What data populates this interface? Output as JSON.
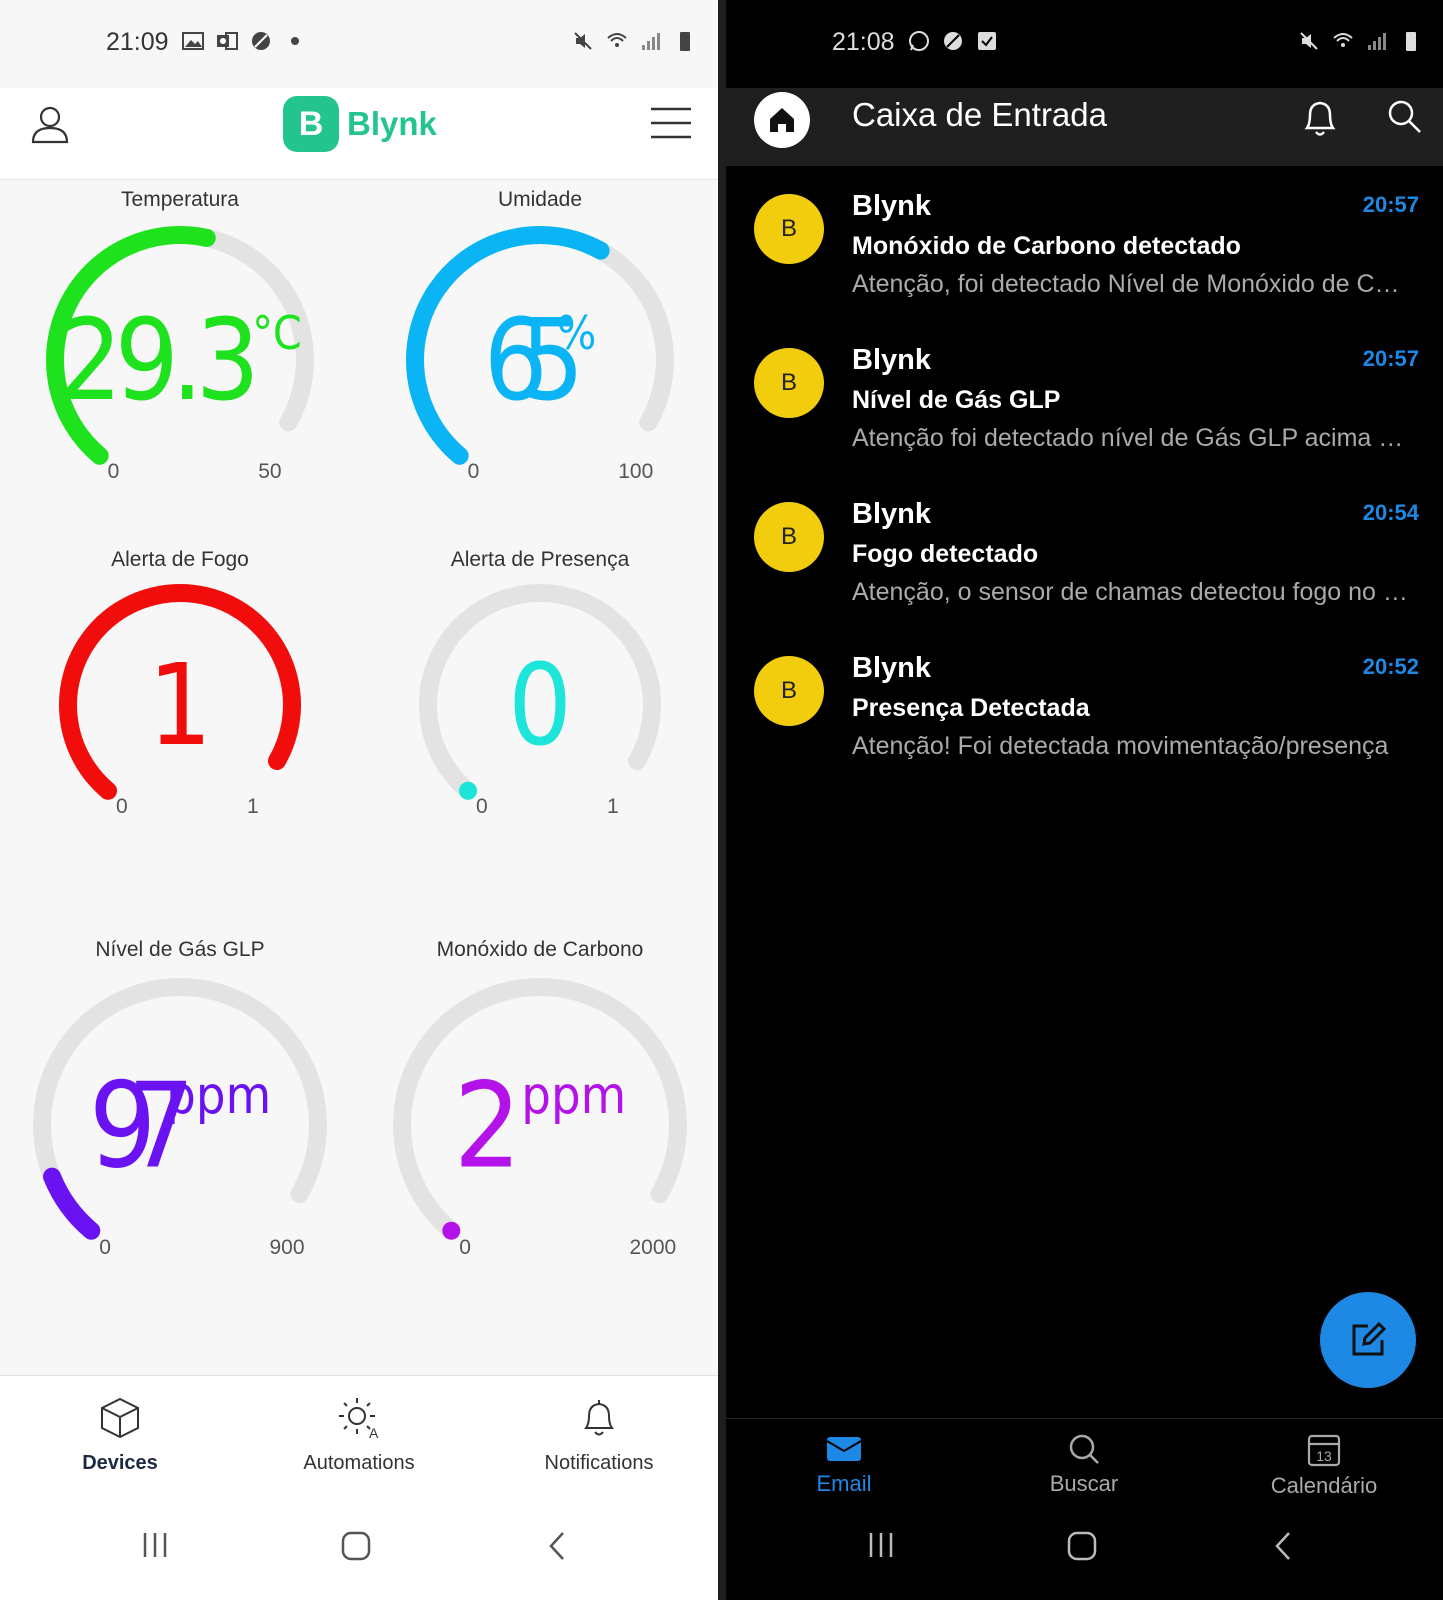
{
  "left_screen": {
    "status_bar": {
      "time": "21:09"
    },
    "header": {
      "logo_letter": "B",
      "app_name": "Blynk"
    },
    "gauges": [
      {
        "id": "temperatura",
        "title": "Temperatura",
        "value": "29.3",
        "unit": "°C",
        "min": "0",
        "max": "50",
        "numeric_value": 29.3,
        "range": [
          0,
          50
        ],
        "color": "#1fe21f"
      },
      {
        "id": "umidade",
        "title": "Umidade",
        "value": "65",
        "unit": "%",
        "min": "0",
        "max": "100",
        "numeric_value": 65,
        "range": [
          0,
          100
        ],
        "color": "#0bb4f4"
      },
      {
        "id": "alerta-fogo",
        "title": "Alerta de Fogo",
        "value": "1",
        "unit": "",
        "min": "0",
        "max": "1",
        "numeric_value": 1,
        "range": [
          0,
          1
        ],
        "color": "#f20d0d"
      },
      {
        "id": "alerta-presenca",
        "title": "Alerta de Presença",
        "value": "0",
        "unit": "",
        "min": "0",
        "max": "1",
        "numeric_value": 0,
        "range": [
          0,
          1
        ],
        "color": "#1de5d9"
      },
      {
        "id": "gas-glp",
        "title": "Nível de Gás GLP",
        "value": "97",
        "unit": "ppm",
        "min": "0",
        "max": "900",
        "numeric_value": 97,
        "range": [
          0,
          900
        ],
        "color": "#6a12f2"
      },
      {
        "id": "monoxido",
        "title": "Monóxido de Carbono",
        "value": "2",
        "unit": "ppm",
        "min": "0",
        "max": "2000",
        "numeric_value": 2,
        "range": [
          0,
          2000
        ],
        "color": "#b313e8"
      }
    ],
    "bottom_nav": [
      {
        "label": "Devices",
        "icon": "cube-icon",
        "active": true
      },
      {
        "label": "Automations",
        "icon": "sun-automation-icon",
        "active": false
      },
      {
        "label": "Notifications",
        "icon": "bell-icon",
        "active": false
      }
    ]
  },
  "right_screen": {
    "status_bar": {
      "time": "21:08"
    },
    "header": {
      "title": "Caixa de Entrada"
    },
    "emails": [
      {
        "avatar": "B",
        "sender": "Blynk",
        "time": "20:57",
        "subject": "Monóxido de Carbono detectado",
        "preview": "Atenção, foi detectado Nível de Monóxido de Carbono"
      },
      {
        "avatar": "B",
        "sender": "Blynk",
        "time": "20:57",
        "subject": "Nível de Gás GLP",
        "preview": "Atenção foi detectado nível de Gás GLP acima do normal"
      },
      {
        "avatar": "B",
        "sender": "Blynk",
        "time": "20:54",
        "subject": "Fogo detectado",
        "preview": "Atenção, o sensor de chamas detectou fogo no ambiente"
      },
      {
        "avatar": "B",
        "sender": "Blynk",
        "time": "20:52",
        "subject": "Presença Detectada",
        "preview": "Atenção! Foi detectada movimentação/presença"
      }
    ],
    "bottom_nav": [
      {
        "label": "Email",
        "icon": "email-icon",
        "active": true
      },
      {
        "label": "Buscar",
        "icon": "search-icon",
        "active": false
      },
      {
        "label": "Calendário",
        "icon": "calendar-icon",
        "badge": "13",
        "active": false
      }
    ]
  },
  "colors": {
    "blynk_green": "#23c48e",
    "outlook_blue": "#1e88e5",
    "avatar_yellow": "#f1cd0e",
    "track_gray": "#e3e3e3"
  }
}
